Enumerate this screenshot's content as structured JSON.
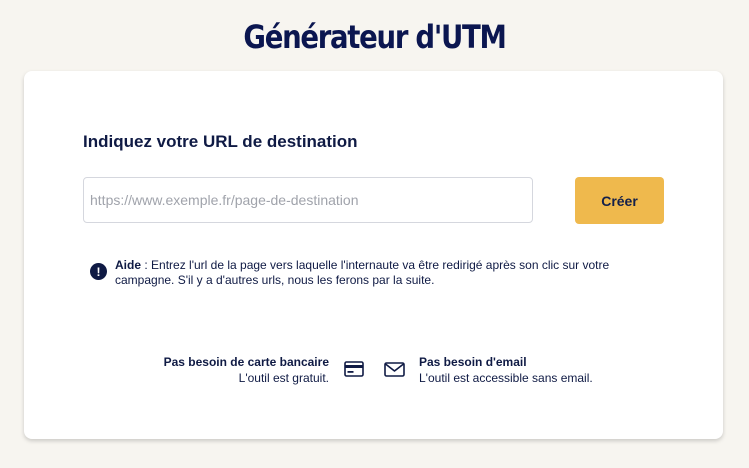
{
  "page": {
    "title": "Générateur d'UTM"
  },
  "form": {
    "heading": "Indiquez votre URL de destination",
    "url_placeholder": "https://www.exemple.fr/page-de-destination",
    "url_value": "",
    "submit_label": "Créer"
  },
  "help": {
    "icon": "exclamation-icon",
    "label": "Aide",
    "text": " : Entrez l'url de la page vers laquelle l'internaute va être redirigé après son clic sur votre campagne. S'il y a d'autres urls, nous les ferons par la suite."
  },
  "features": {
    "card": {
      "icon": "credit-card-icon",
      "title": "Pas besoin de carte bancaire",
      "description": "L'outil est gratuit."
    },
    "email": {
      "icon": "envelope-icon",
      "title": "Pas besoin d'email",
      "description": "L'outil est accessible sans email."
    }
  },
  "colors": {
    "page_background": "#f7f5f0",
    "navy": "#0f1a44",
    "button": "#efb94d"
  }
}
